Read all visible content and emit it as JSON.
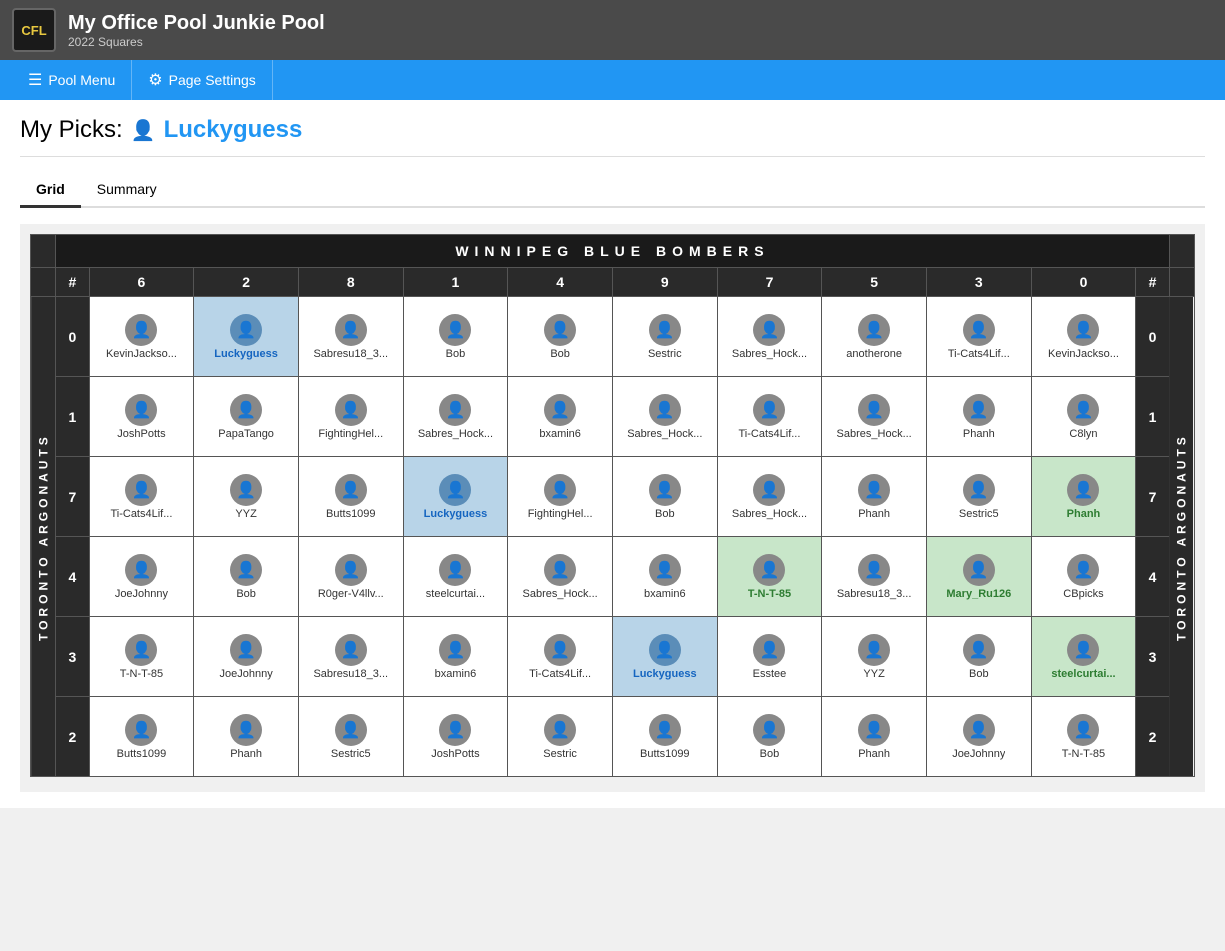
{
  "header": {
    "logo": "CFL",
    "title": "My Office Pool Junkie Pool",
    "subtitle": "2022 Squares"
  },
  "navbar": {
    "menu_label": "Pool Menu",
    "settings_label": "Page Settings"
  },
  "page": {
    "title_prefix": "My Picks:",
    "username": "Luckyguess"
  },
  "tabs": [
    {
      "label": "Grid",
      "active": true
    },
    {
      "label": "Summary",
      "active": false
    }
  ],
  "grid": {
    "away_team": "WINNIPEG BLUE BOMBERS",
    "home_team": "TORONTO ARGONAUTS",
    "col_numbers": [
      "#",
      "6",
      "2",
      "8",
      "1",
      "4",
      "9",
      "7",
      "5",
      "3",
      "0",
      "#"
    ],
    "row_numbers": [
      "0",
      "1",
      "7",
      "4",
      "3",
      "2"
    ],
    "rows": [
      {
        "row_num": "0",
        "cells": [
          {
            "name": "KevinJackso...",
            "highlight": "none"
          },
          {
            "name": "Luckyguess",
            "highlight": "blue"
          },
          {
            "name": "Sabresu18_3...",
            "highlight": "none"
          },
          {
            "name": "Bob",
            "highlight": "none"
          },
          {
            "name": "Bob",
            "highlight": "none"
          },
          {
            "name": "Sestric",
            "highlight": "none"
          },
          {
            "name": "Sabres_Hock...",
            "highlight": "none"
          },
          {
            "name": "anotherone",
            "highlight": "none"
          },
          {
            "name": "Ti-Cats4Lif...",
            "highlight": "none"
          },
          {
            "name": "KevinJackso...",
            "highlight": "none"
          }
        ]
      },
      {
        "row_num": "1",
        "cells": [
          {
            "name": "JoshPotts",
            "highlight": "none"
          },
          {
            "name": "PapaTango",
            "highlight": "none"
          },
          {
            "name": "FightingHel...",
            "highlight": "none"
          },
          {
            "name": "Sabres_Hock...",
            "highlight": "none"
          },
          {
            "name": "bxamin6",
            "highlight": "none"
          },
          {
            "name": "Sabres_Hock...",
            "highlight": "none"
          },
          {
            "name": "Ti-Cats4Lif...",
            "highlight": "none"
          },
          {
            "name": "Sabres_Hock...",
            "highlight": "none"
          },
          {
            "name": "Phanh",
            "highlight": "none"
          },
          {
            "name": "C8lyn",
            "highlight": "none"
          }
        ]
      },
      {
        "row_num": "7",
        "cells": [
          {
            "name": "Ti-Cats4Lif...",
            "highlight": "none"
          },
          {
            "name": "YYZ",
            "highlight": "none"
          },
          {
            "name": "Butts1099",
            "highlight": "none"
          },
          {
            "name": "Luckyguess",
            "highlight": "blue"
          },
          {
            "name": "FightingHel...",
            "highlight": "none"
          },
          {
            "name": "Bob",
            "highlight": "none"
          },
          {
            "name": "Sabres_Hock...",
            "highlight": "none"
          },
          {
            "name": "Phanh",
            "highlight": "none"
          },
          {
            "name": "Sestric5",
            "highlight": "none"
          },
          {
            "name": "Phanh",
            "highlight": "green"
          }
        ]
      },
      {
        "row_num": "4",
        "cells": [
          {
            "name": "JoeJohnny",
            "highlight": "none"
          },
          {
            "name": "Bob",
            "highlight": "none"
          },
          {
            "name": "R0ger-V4llv...",
            "highlight": "none"
          },
          {
            "name": "steelcurtai...",
            "highlight": "none"
          },
          {
            "name": "Sabres_Hock...",
            "highlight": "none"
          },
          {
            "name": "bxamin6",
            "highlight": "none"
          },
          {
            "name": "T-N-T-85",
            "highlight": "green"
          },
          {
            "name": "Sabresu18_3...",
            "highlight": "none"
          },
          {
            "name": "Mary_Ru126",
            "highlight": "green"
          },
          {
            "name": "CBpicks",
            "highlight": "none"
          }
        ]
      },
      {
        "row_num": "3",
        "cells": [
          {
            "name": "T-N-T-85",
            "highlight": "none"
          },
          {
            "name": "JoeJohnny",
            "highlight": "none"
          },
          {
            "name": "Sabresu18_3...",
            "highlight": "none"
          },
          {
            "name": "bxamin6",
            "highlight": "none"
          },
          {
            "name": "Ti-Cats4Lif...",
            "highlight": "none"
          },
          {
            "name": "Luckyguess",
            "highlight": "blue"
          },
          {
            "name": "Esstee",
            "highlight": "none"
          },
          {
            "name": "YYZ",
            "highlight": "none"
          },
          {
            "name": "Bob",
            "highlight": "none"
          },
          {
            "name": "steelcurtai...",
            "highlight": "green"
          }
        ]
      },
      {
        "row_num": "2",
        "cells": [
          {
            "name": "Butts1099",
            "highlight": "none"
          },
          {
            "name": "Phanh",
            "highlight": "none"
          },
          {
            "name": "Sestric5",
            "highlight": "none"
          },
          {
            "name": "JoshPotts",
            "highlight": "none"
          },
          {
            "name": "Sestric",
            "highlight": "none"
          },
          {
            "name": "Butts1099",
            "highlight": "none"
          },
          {
            "name": "Bob",
            "highlight": "none"
          },
          {
            "name": "Phanh",
            "highlight": "none"
          },
          {
            "name": "JoeJohnny",
            "highlight": "none"
          },
          {
            "name": "T-N-T-85",
            "highlight": "none"
          }
        ]
      }
    ]
  }
}
